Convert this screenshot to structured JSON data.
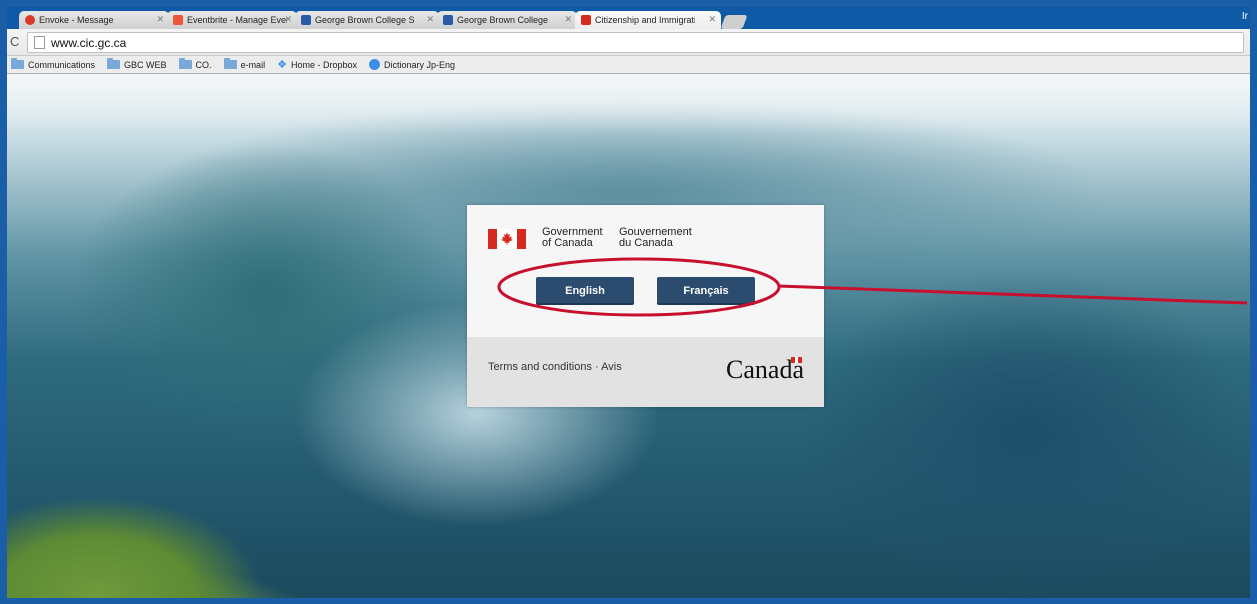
{
  "browser": {
    "tabs": [
      {
        "label": "Envoke - Message",
        "icon_color": "#d83a2a",
        "active": false
      },
      {
        "label": "Eventbrite - Manage Even",
        "icon_color": "#f05537",
        "active": false
      },
      {
        "label": "George Brown College Se",
        "icon_color": "#2a5aa8",
        "active": false
      },
      {
        "label": "George Brown College",
        "icon_color": "#2a5aa8",
        "active": false
      },
      {
        "label": "Citizenship and Immigratio",
        "icon_color": "#d52b1e",
        "active": true
      }
    ],
    "corner_text": "Ir",
    "url": "www.cic.gc.ca",
    "bookmarks": [
      {
        "label": "Communications",
        "icon": "folder-icon"
      },
      {
        "label": "GBC WEB",
        "icon": "folder-icon"
      },
      {
        "label": "CO.",
        "icon": "folder-icon"
      },
      {
        "label": "e-mail",
        "icon": "folder-icon"
      },
      {
        "label": "Home - Dropbox",
        "icon": "dropbox-icon"
      },
      {
        "label": "Dictionary Jp-Eng",
        "icon": "dictionary-icon"
      }
    ]
  },
  "splash": {
    "gov_en_line1": "Government",
    "gov_en_line2": "of Canada",
    "gov_fr_line1": "Gouvernement",
    "gov_fr_line2": "du Canada",
    "btn_english": "English",
    "btn_french": "Français",
    "terms": "Terms and conditions · Avis",
    "wordmark": "Canada"
  },
  "colors": {
    "frame": "#1a5ea8",
    "button": "#2b4b6f",
    "annotation": "#c8102e",
    "flag_red": "#d52b1e"
  }
}
